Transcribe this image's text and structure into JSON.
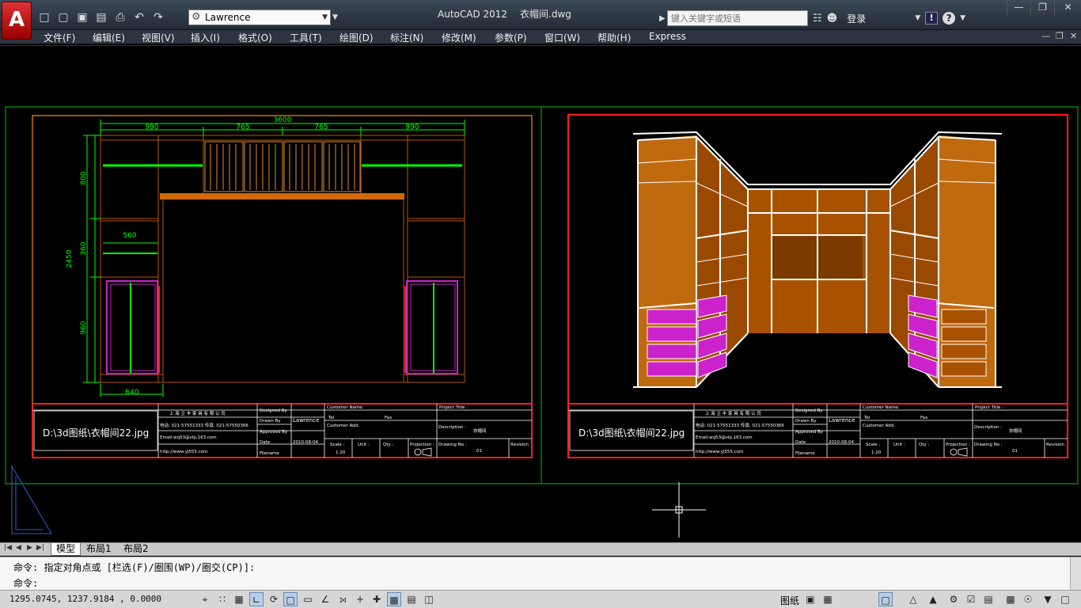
{
  "app": {
    "logo": "A",
    "title": "AutoCAD 2012",
    "file": "衣帽间.dwg",
    "workspace": "Lawrence"
  },
  "search": {
    "placeholder": "键入关键字或短语"
  },
  "login": "登录",
  "menu": [
    "文件(F)",
    "编辑(E)",
    "视图(V)",
    "插入(I)",
    "格式(O)",
    "工具(T)",
    "绘图(D)",
    "标注(N)",
    "修改(M)",
    "参数(P)",
    "窗口(W)",
    "帮助(H)",
    "Express"
  ],
  "drawing": {
    "dims": {
      "total": "3600",
      "d1": "990",
      "d2": "765",
      "d3": "765",
      "d4": "990",
      "v1": "800",
      "v2": "360",
      "v3": "960",
      "vtotal": "2450",
      "w560": "560",
      "w640": "640"
    },
    "title_block": {
      "image_path": "D:\\3d图纸\\衣帽间22.jpg",
      "company": "上 海 立 丰 家 具 有 限 公 司",
      "phone": "电话: 021-57551333 传真: 021-57550366",
      "email": "Email:wq53@vip.163.com",
      "web": "http://www.yj555.com",
      "designed_by": "Designed By",
      "drawn_by": "Drawn By",
      "drawer": "Lawrence",
      "approved_by": "Approved By",
      "date_label": "Date",
      "date": "2010-08-04",
      "filename": "Filename",
      "customer_name": "Customer Name:",
      "tel": "Tel",
      "fax": "Fax",
      "customer_add": "Customer Add:",
      "project_title": "Project Title :",
      "description": "Description :",
      "description_value": "衣帽间",
      "scale": "Scale :",
      "scale_value": "1:20",
      "unit": "Unit :",
      "qty": "Qty :",
      "projection": "Projection :",
      "drawing_no": "Drawing No :",
      "drawing_no_value": "01",
      "revision": "Revision"
    }
  },
  "tabs": [
    "模型",
    "布局1",
    "布局2"
  ],
  "command": {
    "history": "命令: 指定对角点或 [栏选(F)/圈围(WP)/圈交(CP)]:",
    "prompt": "命令:"
  },
  "status": {
    "coords": "1295.0745,  1237.9184 , 0.0000",
    "paper": "图纸"
  },
  "colors": {
    "accent_red": "#ff2020",
    "wood": "#b35a00",
    "dim_green": "#00ff00",
    "drawer_magenta": "#cc22cc"
  }
}
